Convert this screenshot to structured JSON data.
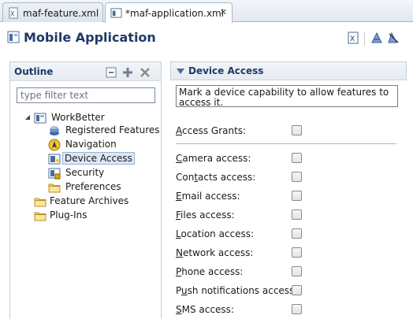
{
  "tabs": [
    {
      "label": "maf-feature.xml"
    },
    {
      "label": "*maf-application.xml"
    }
  ],
  "header": {
    "title": "Mobile Application"
  },
  "outline": {
    "title": "Outline",
    "filter_placeholder": "type filter text",
    "tree": [
      {
        "label": "WorkBetter"
      },
      {
        "label": "Registered Features"
      },
      {
        "label": "Navigation"
      },
      {
        "label": "Device Access"
      },
      {
        "label": "Security"
      },
      {
        "label": "Preferences"
      },
      {
        "label": "Feature Archives"
      },
      {
        "label": "Plug-Ins"
      }
    ]
  },
  "device_access": {
    "title": "Device Access",
    "description": "Mark a device capability to allow features to access it.",
    "grants": {
      "mnemonic": "A",
      "rest": "ccess Grants:",
      "checked": false
    },
    "capabilities": [
      {
        "mnemonic": "C",
        "rest": "amera access:",
        "pre": "",
        "checked": false
      },
      {
        "mnemonic": "t",
        "pre": "Con",
        "rest": "acts access:",
        "checked": false
      },
      {
        "mnemonic": "E",
        "pre": "",
        "rest": "mail access:",
        "checked": false
      },
      {
        "mnemonic": "F",
        "pre": "",
        "rest": "iles access:",
        "checked": false
      },
      {
        "mnemonic": "L",
        "pre": "",
        "rest": "ocation access:",
        "checked": false
      },
      {
        "mnemonic": "N",
        "pre": "",
        "rest": "etwork access:",
        "checked": false
      },
      {
        "mnemonic": "P",
        "pre": "",
        "rest": "hone access:",
        "checked": false
      },
      {
        "mnemonic": "u",
        "pre": "P",
        "rest": "sh notifications access:",
        "checked": false
      },
      {
        "mnemonic": "S",
        "pre": "",
        "rest": "MS access:",
        "checked": false
      }
    ]
  }
}
